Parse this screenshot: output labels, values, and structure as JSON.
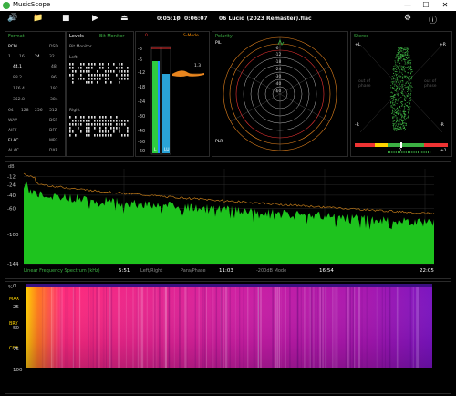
{
  "app": {
    "title": "MusicScope"
  },
  "window_controls": {
    "minimize": "—",
    "maximize": "☐",
    "close": "✕"
  },
  "toolbar": {
    "time_elapsed": "0:05:10",
    "separator": "/",
    "time_total": "0:06:07",
    "track": "06 Lucid (2023 Remaster).flac"
  },
  "format_panel": {
    "title": "Format",
    "pcm": "PCM",
    "dsd": "DSD",
    "bits": [
      "1",
      "16",
      "24",
      "32"
    ],
    "rates_left": [
      "44.1",
      "88.2",
      "176.4",
      "352.8"
    ],
    "rates_right": [
      "48",
      "96",
      "192",
      "384"
    ],
    "dsd_rates": [
      "64",
      "128",
      "256",
      "512"
    ],
    "fmt_left": [
      "WAV",
      "AIFF",
      "FLAC",
      "ALAC"
    ],
    "fmt_right": [
      "DSF",
      "DFF",
      "MP3",
      "DXP"
    ]
  },
  "levels_panel": {
    "title": "Levels",
    "bit_monitor_tab": "Bit Monitor",
    "bit_monitor_label": "Bit Monitor",
    "left_label": "Left",
    "right_label": "Right"
  },
  "meter_panel": {
    "top_left": "0",
    "top_right": "S-Mode",
    "scale": [
      "-3",
      "-6",
      "-12",
      "-18",
      "-24",
      "-30",
      "-40",
      "-50",
      "-60"
    ],
    "peak_value": "1.3",
    "ch_left": "L",
    "ch_right": "LU"
  },
  "polar_panel": {
    "title": "Polarity",
    "pll": "PlL",
    "plr": "PLR",
    "rings": [
      "-6",
      "-12",
      "-18",
      "-24",
      "-30",
      "-40",
      "-60"
    ]
  },
  "stereo_panel": {
    "title": "Stereo",
    "plus_l": "+L",
    "plus_r": "+R",
    "minus_l": "-R",
    "minus_r": "-R",
    "out_of_phase_left": "out of\nphase",
    "out_of_phase_right": "out of\nphase",
    "balance_zero": "0",
    "balance_plus": "+1"
  },
  "spectrum": {
    "db_label": "dB",
    "y_ticks": [
      "-12",
      "-24",
      "-40",
      "-60",
      "-100",
      "-144"
    ],
    "x_ticks": [
      "5:51",
      "11:03",
      "16:54",
      "22:05"
    ],
    "caption": "Linear Frequency Spectrum (kHz)",
    "mode_items": [
      "Left/Right",
      "Para/Phase",
      "-200dB Mode"
    ]
  },
  "spectrogram": {
    "pct_label": "%",
    "y_ticks": [
      "0",
      "25",
      "50",
      "75",
      "100"
    ],
    "side_labels": [
      "MAX",
      "BRY",
      "CCF"
    ]
  }
}
